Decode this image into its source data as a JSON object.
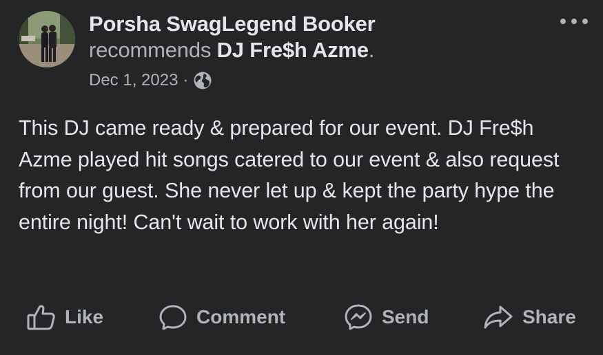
{
  "post": {
    "author": "Porsha SwagLegend Booker",
    "action_verb": "recommends",
    "page_name": "DJ Fre$h Azme",
    "period": ".",
    "date": "Dec 1, 2023",
    "separator": "·",
    "privacy_icon": "globe-icon",
    "body": "This DJ came ready & prepared for our event. DJ Fre$h Azme played hit songs catered to our event & also request from our guest. She never let up & kept the party hype the entire night! Can't wait to work with her again!"
  },
  "actions": {
    "like_label": "Like",
    "comment_label": "Comment",
    "send_label": "Send",
    "share_label": "Share"
  },
  "colors": {
    "background": "#242526",
    "primary_text": "#e4e6eb",
    "secondary_text": "#b0b3b8"
  }
}
